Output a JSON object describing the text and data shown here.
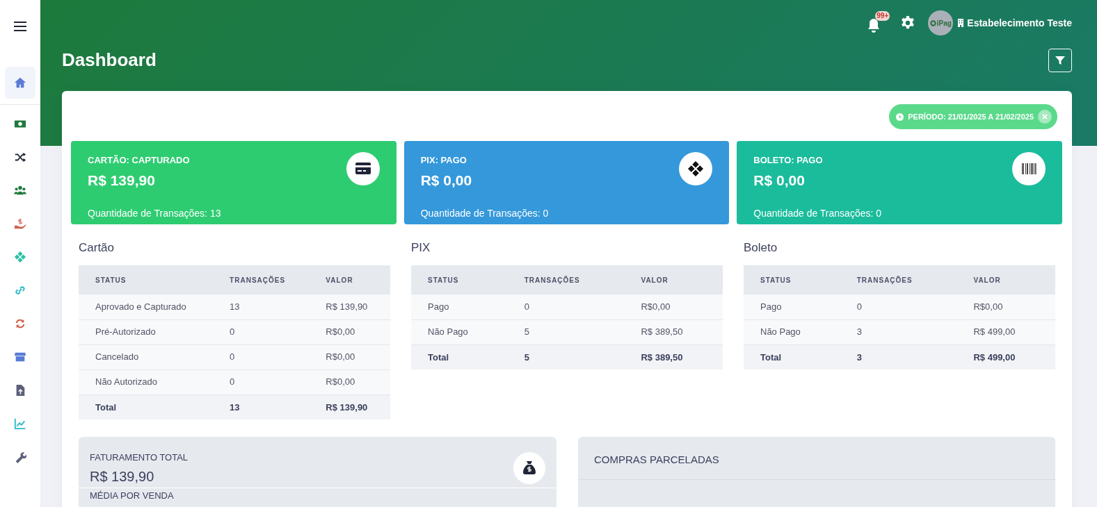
{
  "sidebar": {
    "items": [
      {
        "kind": "home",
        "selected": true
      },
      {
        "kind": "cash",
        "selected": false
      },
      {
        "kind": "shuffle",
        "selected": false
      },
      {
        "kind": "users",
        "selected": false
      },
      {
        "kind": "hand",
        "selected": false
      },
      {
        "kind": "pix",
        "selected": false
      },
      {
        "kind": "link",
        "selected": false
      },
      {
        "kind": "sync",
        "selected": false
      },
      {
        "kind": "store",
        "selected": false
      },
      {
        "kind": "upload",
        "selected": false
      },
      {
        "kind": "chart",
        "selected": false
      },
      {
        "kind": "wrench",
        "selected": false
      }
    ]
  },
  "topbar": {
    "notifications_badge": "99+",
    "avatar_text": "iPag",
    "establishment": "Estabelecimento Teste"
  },
  "title": "Dashboard",
  "period_chip": "PERÍODO: 21/01/2025 A 21/02/2025",
  "stat_cards": [
    {
      "kind": "card",
      "title": "CARTÃO: CAPTURADO",
      "amount": "R$ 139,90",
      "caption": "Quantidade de Transações: 13",
      "color": "#2ecc71"
    },
    {
      "kind": "pix",
      "title": "PIX: PAGO",
      "amount": "R$ 0,00",
      "caption": "Quantidade de Transações: 0",
      "color": "#3498db"
    },
    {
      "kind": "barcode",
      "title": "BOLETO: PAGO",
      "amount": "R$ 0,00",
      "caption": "Quantidade de Transações: 0",
      "color": "#1abc9c"
    }
  ],
  "tables": [
    {
      "title": "Cartão",
      "columns": [
        "STATUS",
        "TRANSAÇÕES",
        "VALOR"
      ],
      "rows": [
        [
          "Aprovado e Capturado",
          "13",
          "R$ 139,90"
        ],
        [
          "Pré-Autorizado",
          "0",
          "R$0,00"
        ],
        [
          "Cancelado",
          "0",
          "R$0,00"
        ],
        [
          "Não Autorizado",
          "0",
          "R$0,00"
        ]
      ],
      "total": [
        "Total",
        "13",
        "R$ 139,90"
      ]
    },
    {
      "title": "PIX",
      "columns": [
        "STATUS",
        "TRANSAÇÕES",
        "VALOR"
      ],
      "rows": [
        [
          "Pago",
          "0",
          "R$0,00"
        ],
        [
          "Não Pago",
          "5",
          "R$ 389,50"
        ]
      ],
      "total": [
        "Total",
        "5",
        "R$ 389,50"
      ]
    },
    {
      "title": "Boleto",
      "columns": [
        "STATUS",
        "TRANSAÇÕES",
        "VALOR"
      ],
      "rows": [
        [
          "Pago",
          "0",
          "R$0,00"
        ],
        [
          "Não Pago",
          "3",
          "R$ 499,00"
        ]
      ],
      "total": [
        "Total",
        "3",
        "R$ 499,00"
      ]
    }
  ],
  "summary": {
    "items": [
      {
        "label": "FATURAMENTO TOTAL",
        "amount": "R$ 139,90"
      },
      {
        "label": "MÉDIA POR VENDA"
      }
    ]
  },
  "installments": {
    "title": "COMPRAS PARCELADAS"
  }
}
